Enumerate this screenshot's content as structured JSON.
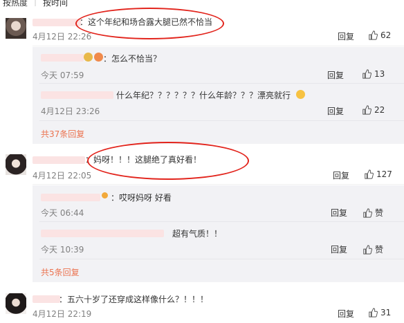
{
  "sort": {
    "hot_label": "按热度",
    "time_label": "按时间"
  },
  "comments": [
    {
      "text": "：这个年纪和场合露大腿已然不恰当",
      "date": "4月12日 22:26",
      "reply_label": "回复",
      "likes": "62",
      "sub_replies": [
        {
          "text": "：怎么不恰当？",
          "date": "今天 07:59",
          "reply_label": "回复",
          "likes": "13"
        },
        {
          "text": "什么年纪？？？？？？什么年龄？？？漂亮就行",
          "date": "4月12日 23:26",
          "reply_label": "回复",
          "likes": "22"
        }
      ],
      "more_label": "共37条回复"
    },
    {
      "text": "：妈呀！！！这腿绝了真好看！",
      "date": "4月12日 22:05",
      "reply_label": "回复",
      "likes": "127",
      "sub_replies": [
        {
          "text": "：哎呀妈呀 好看",
          "date": "今天 06:44",
          "reply_label": "回复",
          "likes": "赞"
        },
        {
          "text": "超有气质！！",
          "date": "今天 10:39",
          "reply_label": "回复",
          "likes": "赞"
        }
      ],
      "more_label": "共5条回复"
    },
    {
      "text": "：五六十岁了还穿成这样像什么？！！！",
      "date": "4月12日 22:19",
      "reply_label": "回复",
      "likes": "31"
    }
  ],
  "colors": {
    "accent": "#eb7350",
    "annotation": "#e2241c",
    "subbox": "#f2f2f5"
  }
}
